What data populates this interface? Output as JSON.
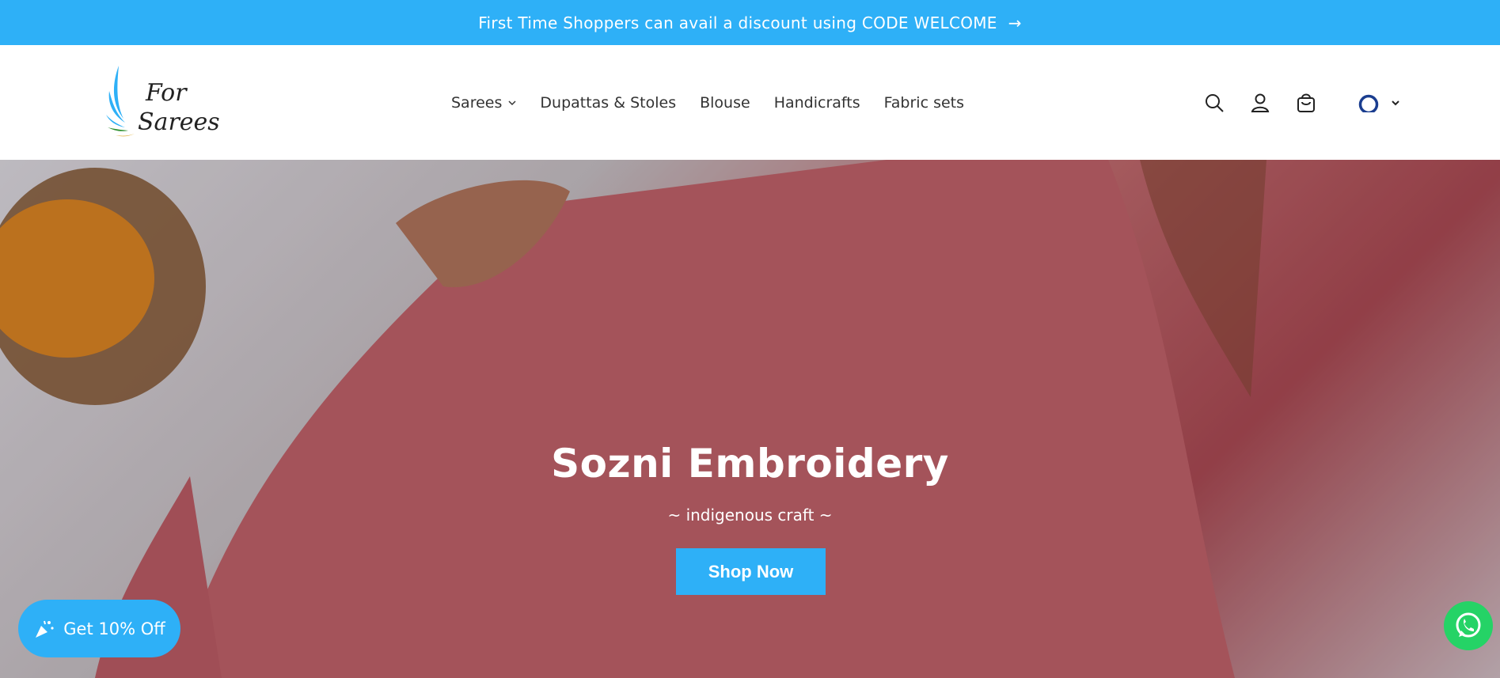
{
  "announcement": {
    "text": "First Time Shoppers can avail a discount using CODE WELCOME",
    "arrow": "→",
    "color": "#2eb0f7"
  },
  "header": {
    "logo": {
      "line1": "For",
      "line2": "Sarees"
    },
    "nav": [
      {
        "label": "Sarees",
        "has_dropdown": true
      },
      {
        "label": "Dupattas & Stoles"
      },
      {
        "label": "Blouse"
      },
      {
        "label": "Handicrafts"
      },
      {
        "label": "Fabric sets"
      }
    ],
    "icons": [
      "search-icon",
      "account-icon",
      "cart-icon",
      "india-flag-icon",
      "chevron-down-icon"
    ]
  },
  "hero": {
    "title": "Sozni Embroidery",
    "subtitle": "~ indigenous craft ~",
    "cta": "Shop Now"
  },
  "widgets": {
    "discount_label": "Get 10% Off",
    "whatsapp": "whatsapp-icon"
  },
  "colors": {
    "accent": "#2eb0f7",
    "whatsapp": "#25d366"
  }
}
